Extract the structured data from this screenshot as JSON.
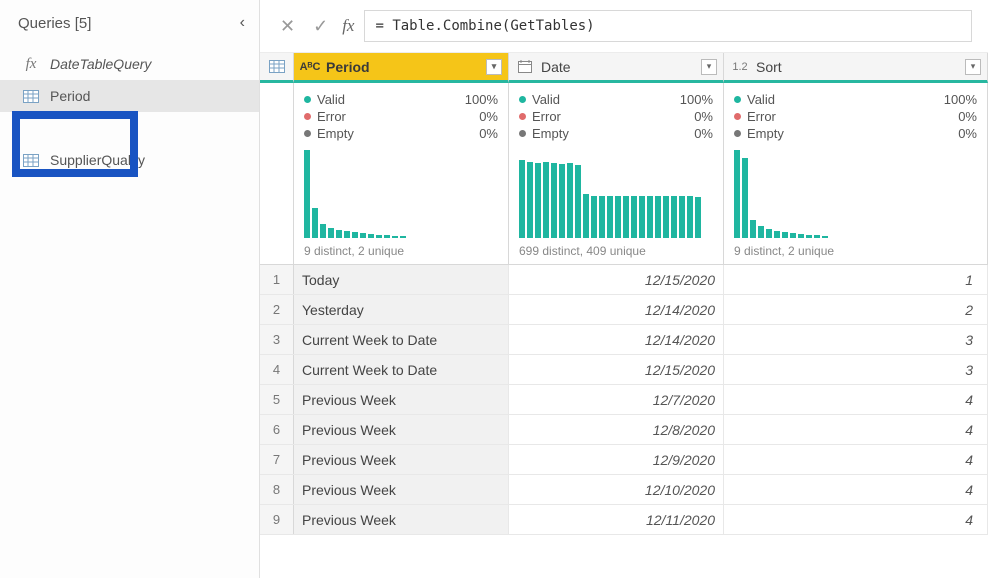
{
  "sidebar": {
    "header": "Queries [5]",
    "items": [
      {
        "label": "DateTableQuery",
        "kind": "fx"
      },
      {
        "label": "Period",
        "kind": "table",
        "selected": true
      },
      {
        "label": "SupplierQuality",
        "kind": "table"
      }
    ]
  },
  "formula_bar": {
    "cancel": "✕",
    "commit": "✓",
    "fx": "fx",
    "formula": "= Table.Combine(GetTables)"
  },
  "columns": [
    {
      "name": "Period",
      "type_label": "AᴮC",
      "selected": true,
      "stats": {
        "valid": "100%",
        "error": "0%",
        "empty": "0%"
      },
      "histogram": [
        88,
        30,
        14,
        10,
        8,
        7,
        6,
        5,
        4,
        3,
        3,
        2,
        2
      ],
      "footer": "9 distinct, 2 unique"
    },
    {
      "name": "Date",
      "type_label": "date",
      "selected": false,
      "stats": {
        "valid": "100%",
        "error": "0%",
        "empty": "0%"
      },
      "histogram": [
        78,
        76,
        75,
        76,
        75,
        74,
        75,
        73,
        44,
        42,
        42,
        42,
        42,
        42,
        42,
        42,
        42,
        42,
        42,
        42,
        42,
        42,
        41
      ],
      "footer": "699 distinct, 409 unique"
    },
    {
      "name": "Sort",
      "type_label": "1.2",
      "selected": false,
      "stats": {
        "valid": "100%",
        "error": "0%",
        "empty": "0%"
      },
      "histogram": [
        88,
        80,
        18,
        12,
        9,
        7,
        6,
        5,
        4,
        3,
        3,
        2
      ],
      "footer": "9 distinct, 2 unique"
    }
  ],
  "stat_labels": {
    "valid": "Valid",
    "error": "Error",
    "empty": "Empty"
  },
  "rows": [
    {
      "n": "1",
      "period": "Today",
      "date": "12/15/2020",
      "sort": "1"
    },
    {
      "n": "2",
      "period": "Yesterday",
      "date": "12/14/2020",
      "sort": "2"
    },
    {
      "n": "3",
      "period": "Current Week to Date",
      "date": "12/14/2020",
      "sort": "3"
    },
    {
      "n": "4",
      "period": "Current Week to Date",
      "date": "12/15/2020",
      "sort": "3"
    },
    {
      "n": "5",
      "period": "Previous Week",
      "date": "12/7/2020",
      "sort": "4"
    },
    {
      "n": "6",
      "period": "Previous Week",
      "date": "12/8/2020",
      "sort": "4"
    },
    {
      "n": "7",
      "period": "Previous Week",
      "date": "12/9/2020",
      "sort": "4"
    },
    {
      "n": "8",
      "period": "Previous Week",
      "date": "12/10/2020",
      "sort": "4"
    },
    {
      "n": "9",
      "period": "Previous Week",
      "date": "12/11/2020",
      "sort": "4"
    }
  ],
  "chart_data": [
    {
      "type": "bar",
      "title": "Period column distribution",
      "values": [
        88,
        30,
        14,
        10,
        8,
        7,
        6,
        5,
        4,
        3,
        3,
        2,
        2
      ],
      "ylim": [
        0,
        90
      ]
    },
    {
      "type": "bar",
      "title": "Date column distribution",
      "values": [
        78,
        76,
        75,
        76,
        75,
        74,
        75,
        73,
        44,
        42,
        42,
        42,
        42,
        42,
        42,
        42,
        42,
        42,
        42,
        42,
        42,
        42,
        41
      ],
      "ylim": [
        0,
        90
      ]
    },
    {
      "type": "bar",
      "title": "Sort column distribution",
      "values": [
        88,
        80,
        18,
        12,
        9,
        7,
        6,
        5,
        4,
        3,
        3,
        2
      ],
      "ylim": [
        0,
        90
      ]
    }
  ]
}
